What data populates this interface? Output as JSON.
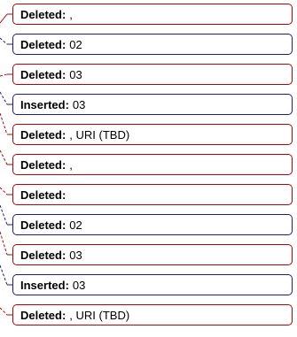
{
  "colors": {
    "deleted_border": "#c00000",
    "inserted_border": "#1a1a9a"
  },
  "balloons": [
    {
      "kind": "Deleted:",
      "text": ",",
      "type": "deleted"
    },
    {
      "kind": "Deleted:",
      "text": "02",
      "type": "inserted"
    },
    {
      "kind": "Deleted:",
      "text": "03",
      "type": "deleted"
    },
    {
      "kind": "Inserted:",
      "text": "03",
      "type": "inserted"
    },
    {
      "kind": "Deleted:",
      "text": ", URI (TBD)",
      "type": "deleted"
    },
    {
      "kind": "Deleted:",
      "text": ",",
      "type": "deleted"
    },
    {
      "kind": "Deleted:",
      "text": "",
      "type": "deleted"
    },
    {
      "kind": "Deleted:",
      "text": "02",
      "type": "inserted"
    },
    {
      "kind": "Deleted:",
      "text": "03",
      "type": "deleted"
    },
    {
      "kind": "Inserted:",
      "text": "03",
      "type": "inserted"
    },
    {
      "kind": "Deleted:",
      "text": ", URI (TBD)",
      "type": "deleted"
    }
  ]
}
